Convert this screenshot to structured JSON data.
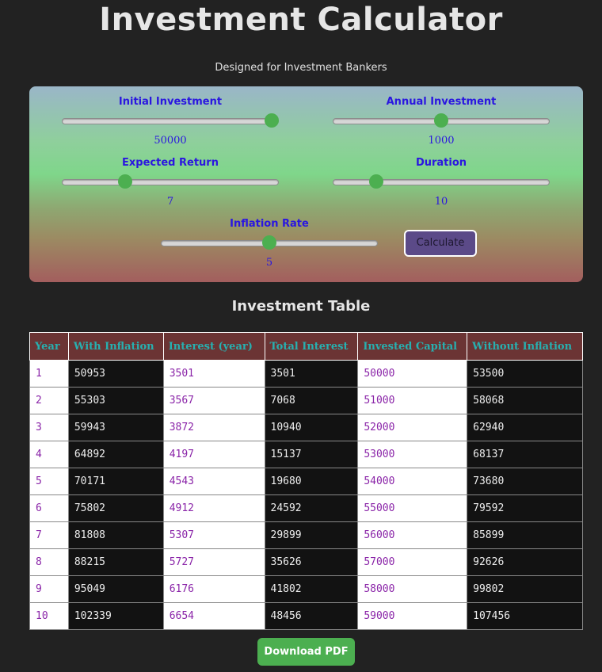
{
  "header": {
    "title": "Investment Calculator",
    "subtitle": "Designed for Investment Bankers"
  },
  "controls": {
    "initial_investment": {
      "label": "Initial Investment",
      "value": "50000",
      "level": 0.97
    },
    "annual_investment": {
      "label": "Annual Investment",
      "value": "1000",
      "level": 0.5
    },
    "expected_return": {
      "label": "Expected Return",
      "value": "7",
      "level": 0.29
    },
    "duration": {
      "label": "Duration",
      "value": "10",
      "level": 0.2
    },
    "inflation_rate": {
      "label": "Inflation Rate",
      "value": "5",
      "level": 0.5
    },
    "calculate_label": "Calculate"
  },
  "table": {
    "title": "Investment Table",
    "headers": [
      "Year",
      "With Inflation",
      "Interest (year)",
      "Total Interest",
      "Invested Capital",
      "Without Inflation"
    ],
    "rows": [
      [
        "1",
        "50953",
        "3501",
        "3501",
        "50000",
        "53500"
      ],
      [
        "2",
        "55303",
        "3567",
        "7068",
        "51000",
        "58068"
      ],
      [
        "3",
        "59943",
        "3872",
        "10940",
        "52000",
        "62940"
      ],
      [
        "4",
        "64892",
        "4197",
        "15137",
        "53000",
        "68137"
      ],
      [
        "5",
        "70171",
        "4543",
        "19680",
        "54000",
        "73680"
      ],
      [
        "6",
        "75802",
        "4912",
        "24592",
        "55000",
        "79592"
      ],
      [
        "7",
        "81808",
        "5307",
        "29899",
        "56000",
        "85899"
      ],
      [
        "8",
        "88215",
        "5727",
        "35626",
        "57000",
        "92626"
      ],
      [
        "9",
        "95049",
        "6176",
        "41802",
        "58000",
        "99802"
      ],
      [
        "10",
        "102339",
        "6654",
        "48456",
        "59000",
        "107456"
      ]
    ]
  },
  "download_label": "Download PDF",
  "colors": {
    "accent": "#4caf50",
    "label": "#2a16e0",
    "table_header_bg": "#6b3434",
    "table_header_text": "#27b0b0",
    "light_cell_text": "#8a24a8"
  }
}
